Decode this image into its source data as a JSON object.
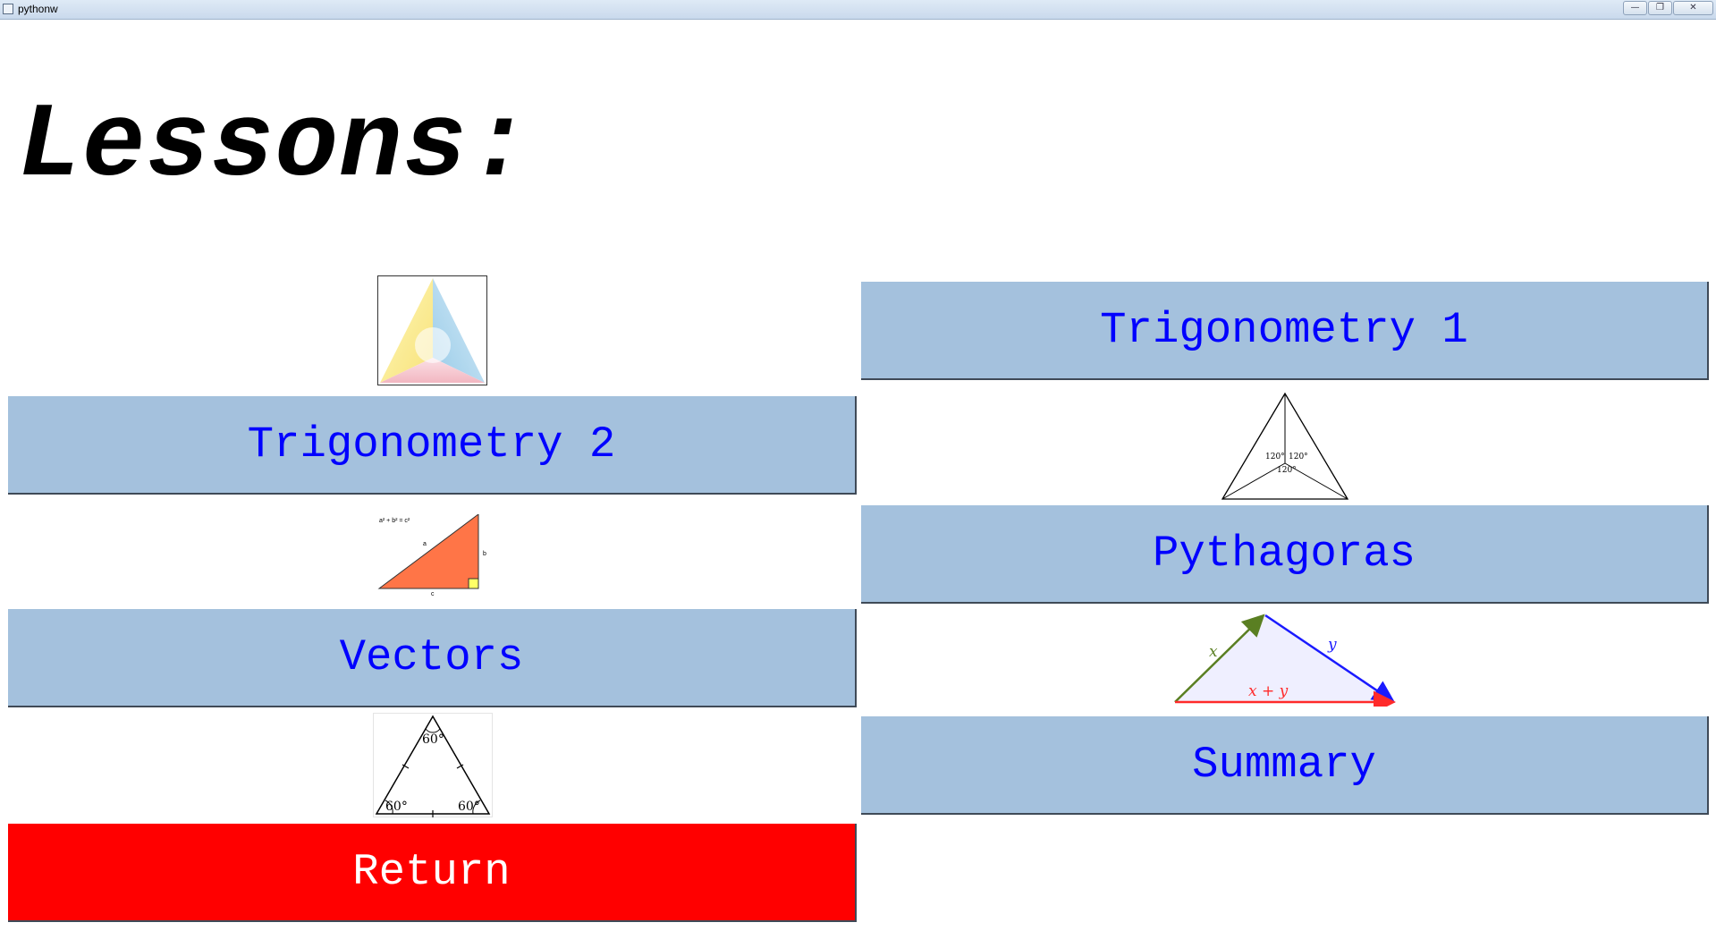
{
  "window": {
    "title": "pythonw",
    "controls": [
      "minimize",
      "maximize",
      "close"
    ]
  },
  "heading": "Lessons:",
  "buttons": {
    "trig1": "Trigonometry 1",
    "trig2": "Trigonometry 2",
    "pythagoras": "Pythagoras",
    "vectors": "Vectors",
    "summary": "Summary",
    "return": "Return"
  },
  "images": {
    "pythagoras_formula": "a² + b² = c²",
    "pythagoras_side_a": "a",
    "pythagoras_side_b": "b",
    "pythagoras_side_c": "c",
    "angle_120": "120°",
    "angle_60": "60°",
    "vector_x": "x",
    "vector_y": "y",
    "vector_sum": "x + y"
  },
  "colors": {
    "button_bg": "#a4c1dd",
    "button_text": "#0000ff",
    "return_bg": "#ff0000",
    "return_text": "#ffffff"
  }
}
